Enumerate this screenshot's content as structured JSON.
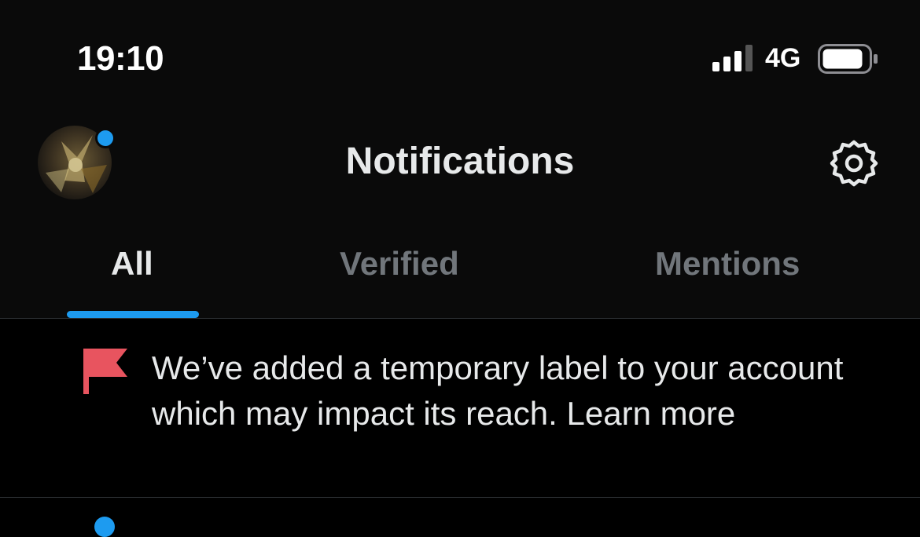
{
  "status_bar": {
    "time": "19:10",
    "network": "4G",
    "signal_bars_lit": 3,
    "signal_bars_total": 4
  },
  "header": {
    "title": "Notifications",
    "avatar_icon": "profile-avatar",
    "settings_icon": "gear-icon",
    "unread_dot_color": "#1d9bf0"
  },
  "tabs": [
    {
      "label": "All",
      "active": true
    },
    {
      "label": "Verified",
      "active": false
    },
    {
      "label": "Mentions",
      "active": false
    }
  ],
  "notifications": [
    {
      "icon": "flag-icon",
      "icon_color": "#e8545f",
      "text": "We’ve added a temporary label to your account which may impact its reach. Learn more"
    }
  ],
  "colors": {
    "accent": "#1d9bf0",
    "background": "#000000",
    "text_primary": "#e7e9ea",
    "text_secondary": "#71767b"
  }
}
